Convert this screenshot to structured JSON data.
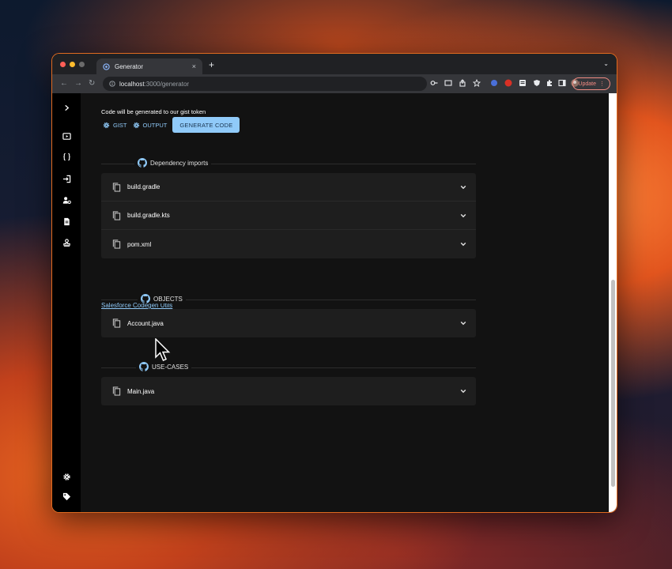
{
  "browser": {
    "tab_title": "Generator",
    "tab_close": "×",
    "new_tab": "+",
    "tab_menu": "⌄",
    "url_host": "localhost",
    "url_path": ":3000/generator",
    "update_label": "Update"
  },
  "toolbar": {
    "back": "←",
    "forward": "→",
    "reload": "↻"
  },
  "page": {
    "info_text": "Code will be generated to our gist token",
    "actions": {
      "gist_label": "Gist",
      "output_label": "Output",
      "generate_label": "Generate code"
    },
    "sections": {
      "dependency": {
        "title": "Dependency imports",
        "items": [
          {
            "label": "build.gradle"
          },
          {
            "label": "build.gradle.kts"
          },
          {
            "label": "pom.xml"
          }
        ]
      },
      "link_text": "Salesforce Codegen Utils",
      "objects": {
        "title": "OBJECTS",
        "items": [
          {
            "label": "Account.java"
          }
        ]
      },
      "use_cases": {
        "title": "USE-CASES",
        "items": [
          {
            "label": "Main.java"
          }
        ]
      }
    }
  },
  "colors": {
    "accent": "#90caf9",
    "background": "#121212",
    "card": "#1e1e1e",
    "sidebar": "#000000"
  },
  "icons": {
    "sidebar_top": [
      "chevron-right-icon"
    ],
    "sidebar_items": [
      "media-icon",
      "braces-icon",
      "login-icon",
      "user-settings-icon",
      "document-icon",
      "stamp-icon"
    ],
    "sidebar_bottom": [
      "gear-icon",
      "tag-icon"
    ]
  }
}
